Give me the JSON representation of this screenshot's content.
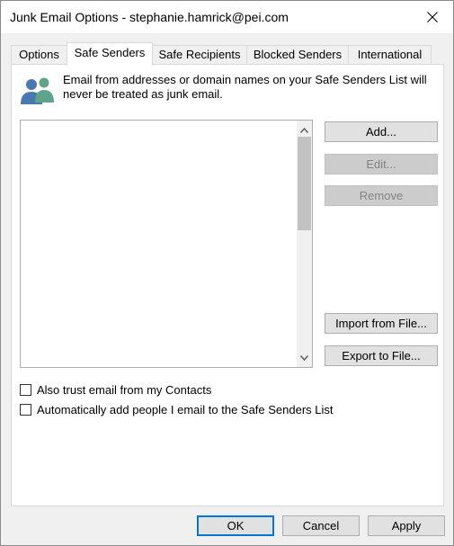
{
  "window": {
    "title": "Junk Email Options - stephanie.hamrick@pei.com"
  },
  "tabs": [
    {
      "label": "Options",
      "active": false
    },
    {
      "label": "Safe Senders",
      "active": true
    },
    {
      "label": "Safe Recipients",
      "active": false
    },
    {
      "label": "Blocked Senders",
      "active": false
    },
    {
      "label": "International",
      "active": false
    }
  ],
  "safe_senders": {
    "description": "Email from addresses or domain names on your Safe Senders List will never be treated as junk email.",
    "list_items": [],
    "buttons": {
      "add": "Add...",
      "edit": "Edit...",
      "remove": "Remove",
      "import": "Import from File...",
      "export": "Export to File..."
    },
    "checkboxes": {
      "trust_contacts": {
        "label": "Also trust email from my Contacts",
        "checked": false
      },
      "auto_add": {
        "label": "Automatically add people I email to the Safe Senders List",
        "checked": false
      }
    }
  },
  "footer": {
    "ok": "OK",
    "cancel": "Cancel",
    "apply": "Apply"
  },
  "colors": {
    "accent": "#0078d7",
    "icon_person_left": "#4a78b0",
    "icon_person_right": "#5fa48a"
  }
}
